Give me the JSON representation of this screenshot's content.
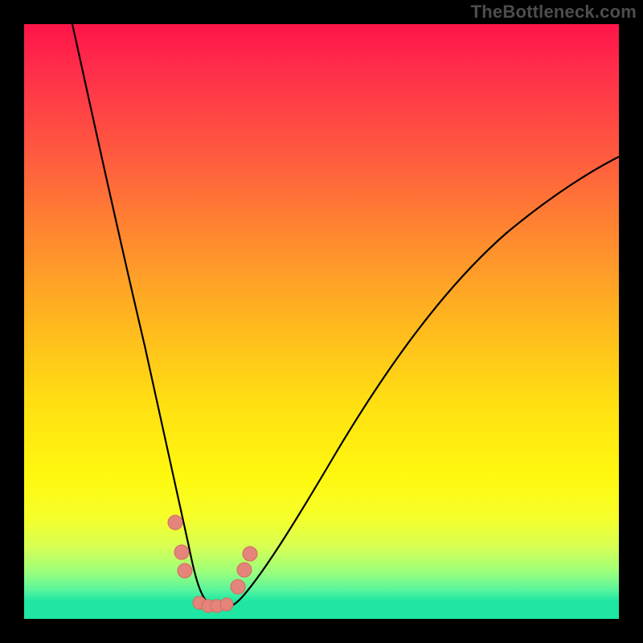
{
  "watermark": "TheBottleneck.com",
  "chart_data": {
    "type": "line",
    "title": "",
    "xlabel": "",
    "ylabel": "",
    "xlim": [
      0,
      100
    ],
    "ylim": [
      0,
      100
    ],
    "grid": false,
    "gradient_stops": [
      {
        "pos": 0,
        "color": "#ff1549"
      },
      {
        "pos": 22,
        "color": "#ff5a3f"
      },
      {
        "pos": 50,
        "color": "#ffb71f"
      },
      {
        "pos": 76,
        "color": "#fff80f"
      },
      {
        "pos": 92,
        "color": "#9dff7a"
      },
      {
        "pos": 100,
        "color": "#1fe7a3"
      }
    ],
    "series": [
      {
        "name": "curve",
        "x": [
          8,
          10,
          13,
          16,
          19,
          22,
          24,
          26,
          27.5,
          29,
          30.5,
          32,
          34,
          37,
          41,
          46,
          52,
          58,
          64,
          70,
          76,
          82,
          88,
          94,
          100
        ],
        "y": [
          100,
          90,
          77,
          64,
          52,
          40,
          30,
          20,
          12,
          6,
          2.5,
          1.5,
          1.5,
          2.5,
          6,
          12,
          20,
          29,
          38,
          46,
          53,
          59,
          64,
          68,
          71
        ]
      }
    ],
    "points": [
      {
        "x": 25.5,
        "y": 15,
        "r": 1.2
      },
      {
        "x": 26.5,
        "y": 10,
        "r": 1.2
      },
      {
        "x": 27.0,
        "y": 7,
        "r": 1.2
      },
      {
        "x": 29.5,
        "y": 2.5,
        "r": 1.1
      },
      {
        "x": 31.0,
        "y": 2.0,
        "r": 1.1
      },
      {
        "x": 32.5,
        "y": 2.0,
        "r": 1.1
      },
      {
        "x": 34.0,
        "y": 2.3,
        "r": 1.1
      },
      {
        "x": 36.0,
        "y": 5,
        "r": 1.2
      },
      {
        "x": 37.0,
        "y": 8,
        "r": 1.2
      },
      {
        "x": 38.0,
        "y": 11,
        "r": 1.2
      }
    ]
  }
}
